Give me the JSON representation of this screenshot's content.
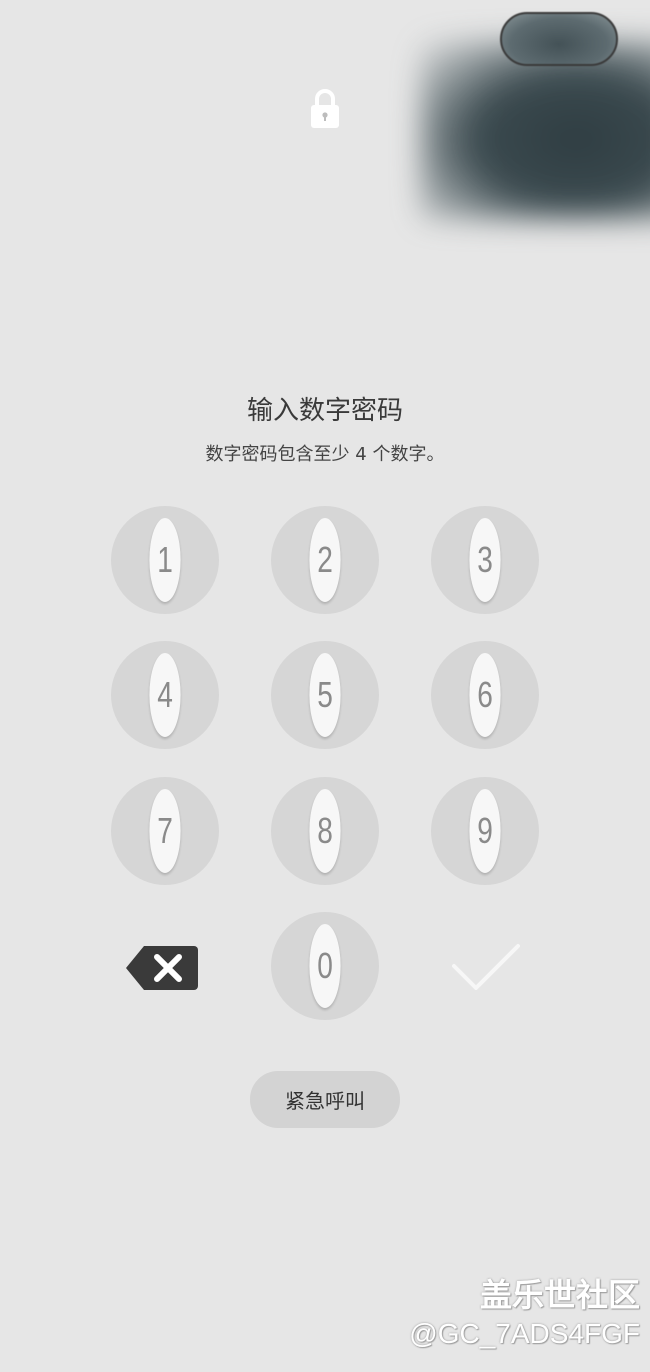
{
  "lock_screen": {
    "title": "输入数字密码",
    "subtitle": "数字密码包含至少 4 个数字。",
    "keypad": {
      "keys": [
        "1",
        "2",
        "3",
        "4",
        "5",
        "6",
        "7",
        "8",
        "9",
        "0"
      ]
    },
    "emergency_call_label": "紧急呼叫"
  },
  "watermark": {
    "title": "盖乐世社区",
    "handle": "@GC_7ADS4FGF"
  },
  "icons": {
    "lock": "lock-icon",
    "backspace": "backspace-icon",
    "confirm": "check-icon"
  },
  "colors": {
    "background": "#e6e6e6",
    "key_circle": "#d6d6d6",
    "key_oval": "#f7f7f7",
    "key_digit": "#8a8a8a",
    "backspace": "#3a3a3a",
    "emergency_button": "#d3d3d3"
  }
}
